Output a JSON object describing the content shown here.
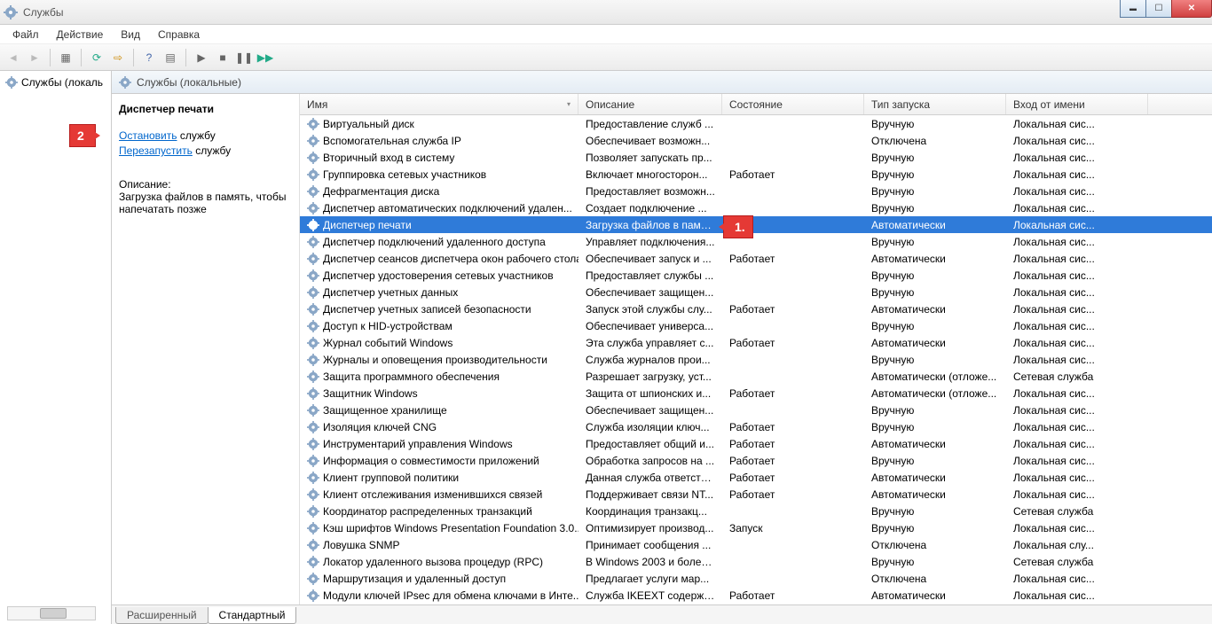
{
  "window": {
    "title": "Службы"
  },
  "menu": {
    "file": "Файл",
    "action": "Действие",
    "view": "Вид",
    "help": "Справка"
  },
  "tree": {
    "root": "Службы (локаль"
  },
  "content_header": "Службы (локальные)",
  "taskpane": {
    "selected_name": "Диспетчер печати",
    "stop_link": "Остановить",
    "stop_suffix": " службу",
    "restart_link": "Перезапустить",
    "restart_suffix": " службу",
    "desc_label": "Описание:",
    "desc_text": "Загрузка файлов в память, чтобы напечатать позже"
  },
  "columns": {
    "name": "Имя",
    "description": "Описание",
    "status": "Состояние",
    "startup": "Тип запуска",
    "logon": "Вход от имени"
  },
  "tabs": {
    "extended": "Расширенный",
    "standard": "Стандартный"
  },
  "annotations": {
    "a1": "1.",
    "a2": "2."
  },
  "services": [
    {
      "name": "Виртуальный диск",
      "desc": "Предоставление служб ...",
      "status": "",
      "startup": "Вручную",
      "logon": "Локальная сис..."
    },
    {
      "name": "Вспомогательная служба IP",
      "desc": "Обеспечивает возможн...",
      "status": "",
      "startup": "Отключена",
      "logon": "Локальная сис..."
    },
    {
      "name": "Вторичный вход в систему",
      "desc": "Позволяет запускать пр...",
      "status": "",
      "startup": "Вручную",
      "logon": "Локальная сис..."
    },
    {
      "name": "Группировка сетевых участников",
      "desc": "Включает многосторон...",
      "status": "Работает",
      "startup": "Вручную",
      "logon": "Локальная сис..."
    },
    {
      "name": "Дефрагментация диска",
      "desc": "Предоставляет возможн...",
      "status": "",
      "startup": "Вручную",
      "logon": "Локальная сис..."
    },
    {
      "name": "Диспетчер автоматических подключений удален...",
      "desc": "Создает подключение ...",
      "status": "",
      "startup": "Вручную",
      "logon": "Локальная сис..."
    },
    {
      "name": "Диспетчер печати",
      "desc": "Загрузка файлов в памя...",
      "status": "",
      "startup": "Автоматически",
      "logon": "Локальная сис...",
      "selected": true
    },
    {
      "name": "Диспетчер подключений удаленного доступа",
      "desc": "Управляет подключения...",
      "status": "",
      "startup": "Вручную",
      "logon": "Локальная сис..."
    },
    {
      "name": "Диспетчер сеансов диспетчера окон рабочего стола",
      "desc": "Обеспечивает запуск и ...",
      "status": "Работает",
      "startup": "Автоматически",
      "logon": "Локальная сис..."
    },
    {
      "name": "Диспетчер удостоверения сетевых участников",
      "desc": "Предоставляет службы ...",
      "status": "",
      "startup": "Вручную",
      "logon": "Локальная сис..."
    },
    {
      "name": "Диспетчер учетных данных",
      "desc": "Обеспечивает защищен...",
      "status": "",
      "startup": "Вручную",
      "logon": "Локальная сис..."
    },
    {
      "name": "Диспетчер учетных записей безопасности",
      "desc": "Запуск этой службы слу...",
      "status": "Работает",
      "startup": "Автоматически",
      "logon": "Локальная сис..."
    },
    {
      "name": "Доступ к HID-устройствам",
      "desc": "Обеспечивает универса...",
      "status": "",
      "startup": "Вручную",
      "logon": "Локальная сис..."
    },
    {
      "name": "Журнал событий Windows",
      "desc": "Эта служба управляет с...",
      "status": "Работает",
      "startup": "Автоматически",
      "logon": "Локальная сис..."
    },
    {
      "name": "Журналы и оповещения производительности",
      "desc": "Служба журналов прои...",
      "status": "",
      "startup": "Вручную",
      "logon": "Локальная сис..."
    },
    {
      "name": "Защита программного обеспечения",
      "desc": "Разрешает загрузку, уст...",
      "status": "",
      "startup": "Автоматически (отложе...",
      "logon": "Сетевая служба"
    },
    {
      "name": "Защитник Windows",
      "desc": "Защита от шпионских  и...",
      "status": "Работает",
      "startup": "Автоматически (отложе...",
      "logon": "Локальная сис..."
    },
    {
      "name": "Защищенное хранилище",
      "desc": "Обеспечивает защищен...",
      "status": "",
      "startup": "Вручную",
      "logon": "Локальная сис..."
    },
    {
      "name": "Изоляция ключей CNG",
      "desc": "Служба изоляции ключ...",
      "status": "Работает",
      "startup": "Вручную",
      "logon": "Локальная сис..."
    },
    {
      "name": "Инструментарий управления Windows",
      "desc": "Предоставляет общий и...",
      "status": "Работает",
      "startup": "Автоматически",
      "logon": "Локальная сис..."
    },
    {
      "name": "Информация о совместимости приложений",
      "desc": "Обработка запросов на ...",
      "status": "Работает",
      "startup": "Вручную",
      "logon": "Локальная сис..."
    },
    {
      "name": "Клиент групповой политики",
      "desc": "Данная служба ответств...",
      "status": "Работает",
      "startup": "Автоматически",
      "logon": "Локальная сис..."
    },
    {
      "name": "Клиент отслеживания изменившихся связей",
      "desc": "Поддерживает связи NT...",
      "status": "Работает",
      "startup": "Автоматически",
      "logon": "Локальная сис..."
    },
    {
      "name": "Координатор распределенных транзакций",
      "desc": "Координация транзакц...",
      "status": "",
      "startup": "Вручную",
      "logon": "Сетевая служба"
    },
    {
      "name": "Кэш шрифтов Windows Presentation Foundation 3.0....",
      "desc": "Оптимизирует производ...",
      "status": "Запуск",
      "startup": "Вручную",
      "logon": "Локальная сис..."
    },
    {
      "name": "Ловушка SNMP",
      "desc": "Принимает сообщения ...",
      "status": "",
      "startup": "Отключена",
      "logon": "Локальная слу..."
    },
    {
      "name": "Локатор удаленного вызова процедур (RPC)",
      "desc": "В Windows 2003 и более ...",
      "status": "",
      "startup": "Вручную",
      "logon": "Сетевая служба"
    },
    {
      "name": "Маршрутизация и удаленный доступ",
      "desc": "Предлагает услуги мар...",
      "status": "",
      "startup": "Отключена",
      "logon": "Локальная сис..."
    },
    {
      "name": "Модули ключей IPsec для обмена ключами в Инте...",
      "desc": "Служба IKEEXT содержи...",
      "status": "Работает",
      "startup": "Автоматически",
      "logon": "Локальная сис..."
    }
  ]
}
